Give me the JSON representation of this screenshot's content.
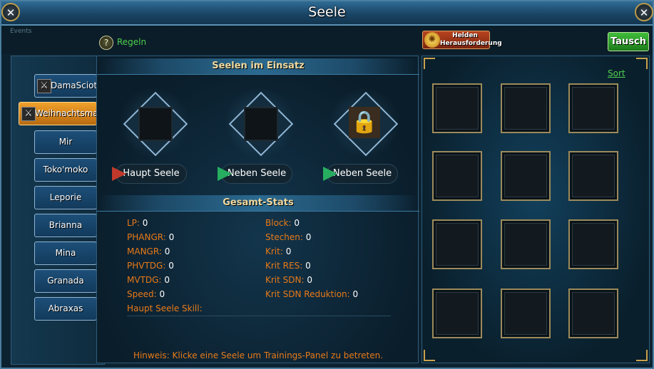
{
  "window": {
    "title": "Seele",
    "close_symbol": "✕"
  },
  "header": {
    "events_label": "Events",
    "help_label": "Regeln",
    "help_symbol": "?",
    "hero_button": {
      "line1": "Helden",
      "line2": "Herausforderung",
      "icon": "swirl-icon"
    },
    "trade_button": "Tausch"
  },
  "sidebar": {
    "items": [
      {
        "label": "DamaSciotu",
        "icon": "crossed-swords-icon",
        "active": false
      },
      {
        "label": "Weihnachtsma",
        "icon": "crossed-swords-icon",
        "active": true
      },
      {
        "label": "Mir"
      },
      {
        "label": "Toko'moko"
      },
      {
        "label": "Leporie"
      },
      {
        "label": "Brianna"
      },
      {
        "label": "Mina"
      },
      {
        "label": "Granada"
      },
      {
        "label": "Abraxas"
      }
    ]
  },
  "souls": {
    "header": "Seelen im Einsatz",
    "slots": [
      {
        "prefix": "Haupt",
        "label": "Seele",
        "locked": false
      },
      {
        "prefix": "Neben",
        "label": "Seele",
        "locked": false
      },
      {
        "prefix": "Neben",
        "label": "Seele",
        "locked": true
      }
    ]
  },
  "stats": {
    "header": "Gesamt-Stats",
    "left": [
      {
        "name": "LP:",
        "value": "0"
      },
      {
        "name": "PHANGR:",
        "value": "0"
      },
      {
        "name": "MANGR:",
        "value": "0"
      },
      {
        "name": "PHVTDG:",
        "value": "0"
      },
      {
        "name": "MVTDG:",
        "value": "0"
      },
      {
        "name": "Speed:",
        "value": "0"
      }
    ],
    "right": [
      {
        "name": "Block:",
        "value": "0"
      },
      {
        "name": "Stechen:",
        "value": "0"
      },
      {
        "name": "Krit:",
        "value": "0"
      },
      {
        "name": "Krit RES:",
        "value": "0"
      },
      {
        "name": "Krit SDN:",
        "value": "0"
      },
      {
        "name": "Krit SDN Reduktion:",
        "value": "0"
      }
    ],
    "skill_label": "Haupt Seele Skill:"
  },
  "hint": "Hinweis: Klicke eine Seele um Trainings-Panel zu betreten.",
  "inventory": {
    "sort_label": "Sort",
    "slot_count": 12
  }
}
